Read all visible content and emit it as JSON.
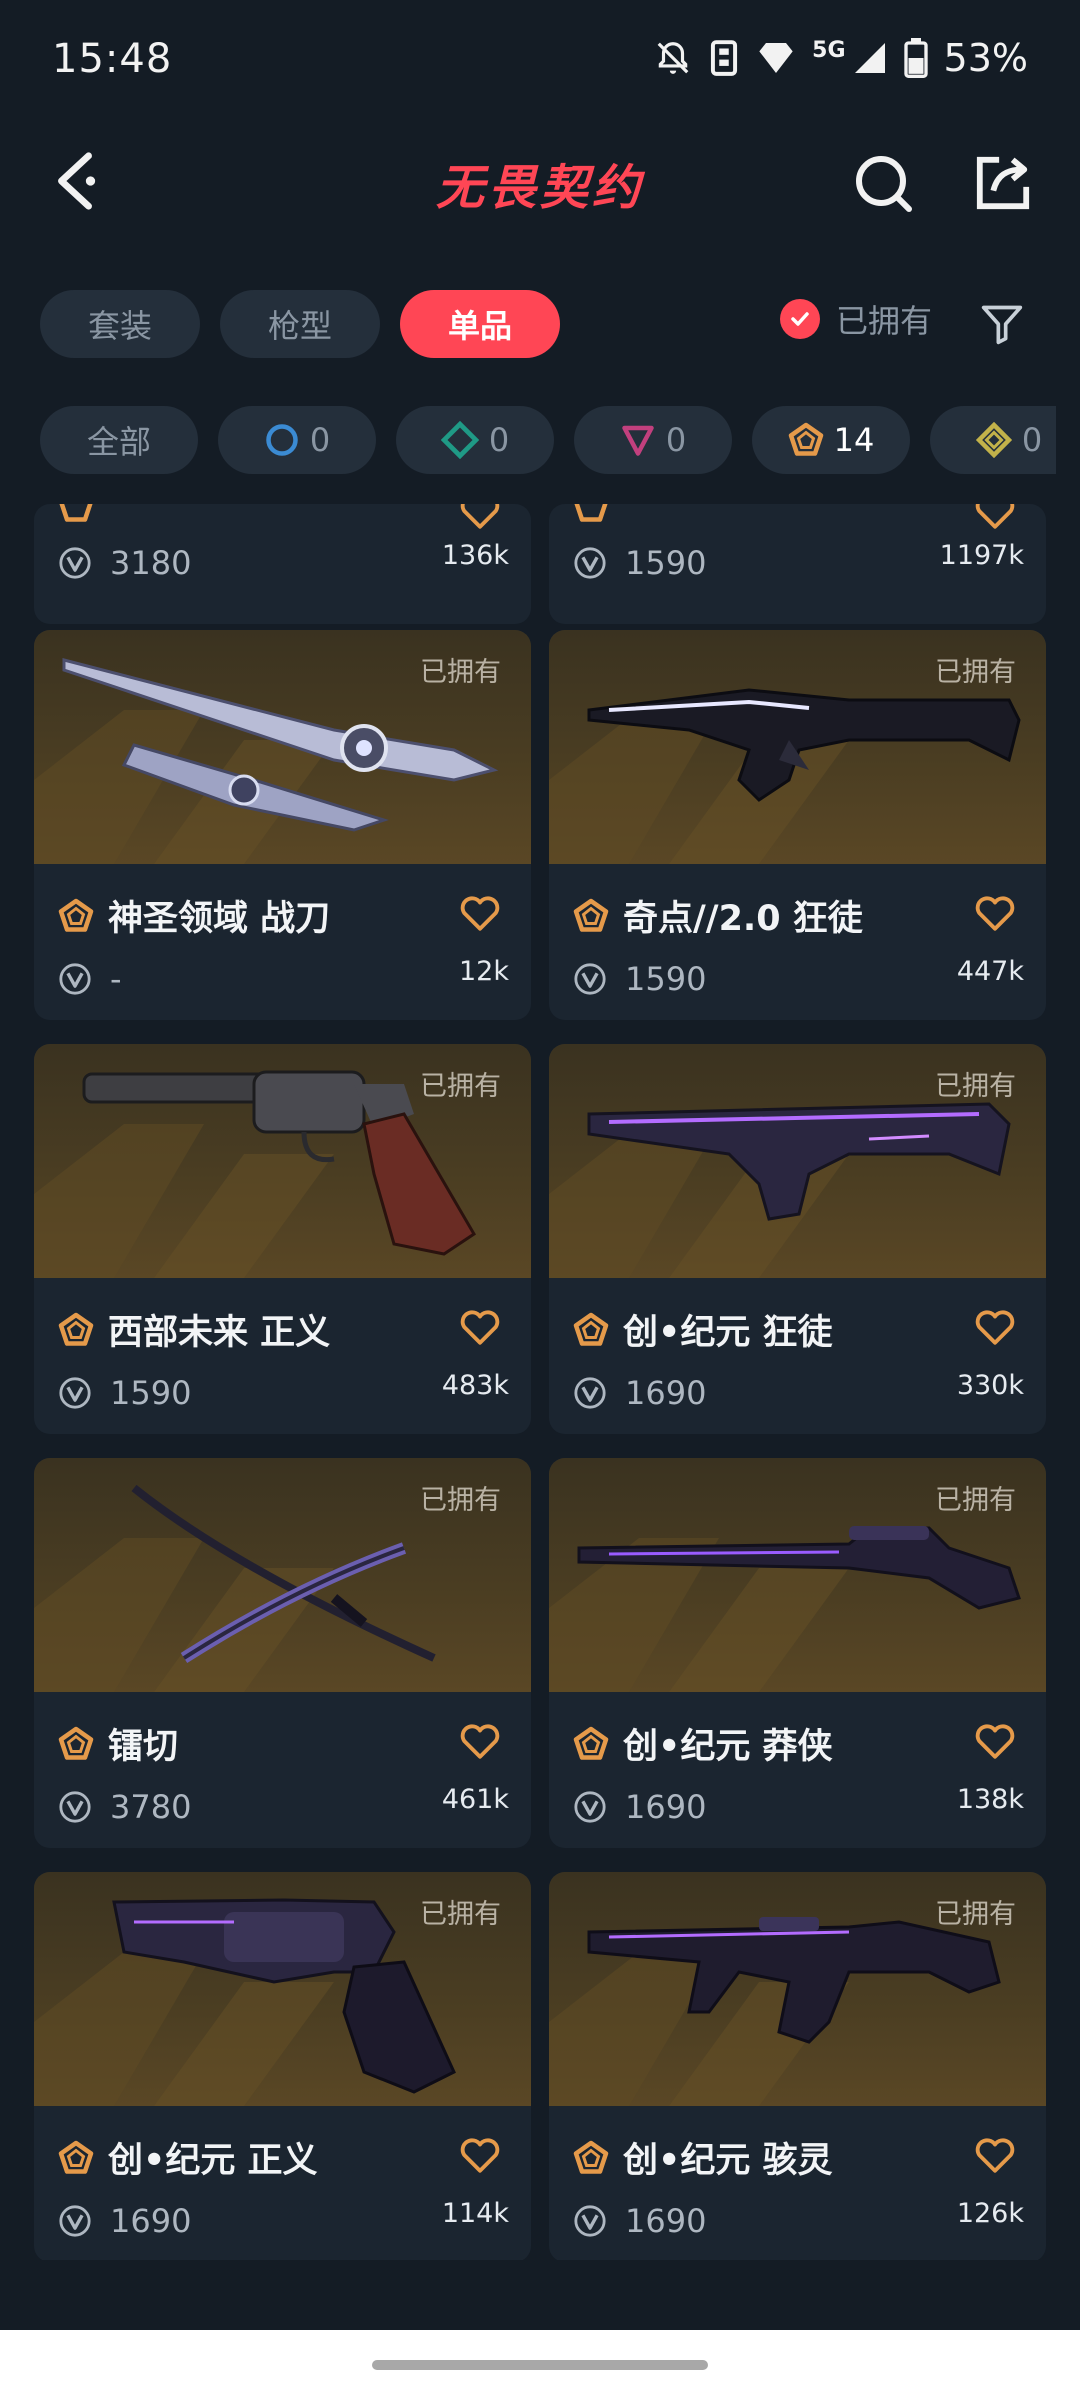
{
  "status_bar": {
    "time": "15:48",
    "network": "5G",
    "battery": "53%"
  },
  "header": {
    "title": "无畏契约"
  },
  "tabs": [
    {
      "label": "套装",
      "active": false
    },
    {
      "label": "枪型",
      "active": false
    },
    {
      "label": "单品",
      "active": true
    }
  ],
  "owned_filter": {
    "label": "已拥有",
    "checked": true
  },
  "rarity_chips": [
    {
      "label": "全部",
      "icon": "",
      "count": ""
    },
    {
      "label": "",
      "icon": "select-tier-icon",
      "color": "#3b8bd3",
      "count": "0"
    },
    {
      "label": "",
      "icon": "deluxe-tier-icon",
      "color": "#1f9a86",
      "count": "0"
    },
    {
      "label": "",
      "icon": "premium-tier-icon",
      "color": "#c2407e",
      "count": "0"
    },
    {
      "label": "",
      "icon": "ultra-tier-icon",
      "color": "#e59a4a",
      "count": "14"
    },
    {
      "label": "",
      "icon": "exclusive-tier-icon",
      "color": "#c2b24a",
      "count": "0"
    }
  ],
  "accent_color": "#ff4655",
  "tier_color": "#e59a4a",
  "items": [
    {
      "name": "",
      "price": "3180",
      "likes": "136k",
      "owned": "",
      "weapon": ""
    },
    {
      "name": "",
      "price": "1590",
      "likes": "1197k",
      "owned": "",
      "weapon": ""
    },
    {
      "name": "神圣领域 战刀",
      "price": "-",
      "likes": "12k",
      "owned": "已拥有",
      "weapon": "knife"
    },
    {
      "name": "奇点//2.0 狂徒",
      "price": "1590",
      "likes": "447k",
      "owned": "已拥有",
      "weapon": "rifle-dark"
    },
    {
      "name": "西部未来 正义",
      "price": "1590",
      "likes": "483k",
      "owned": "已拥有",
      "weapon": "revolver-classic"
    },
    {
      "name": "创•纪元 狂徒",
      "price": "1690",
      "likes": "330k",
      "owned": "已拥有",
      "weapon": "rifle-purple"
    },
    {
      "name": "镭切",
      "price": "3780",
      "likes": "461k",
      "owned": "已拥有",
      "weapon": "sword"
    },
    {
      "name": "创•纪元 莽侠",
      "price": "1690",
      "likes": "138k",
      "owned": "已拥有",
      "weapon": "sniper"
    },
    {
      "name": "创•纪元 正义",
      "price": "1690",
      "likes": "114k",
      "owned": "已拥有",
      "weapon": "revolver-purple"
    },
    {
      "name": "创•纪元 骇灵",
      "price": "1690",
      "likes": "126k",
      "owned": "已拥有",
      "weapon": "smg"
    }
  ]
}
